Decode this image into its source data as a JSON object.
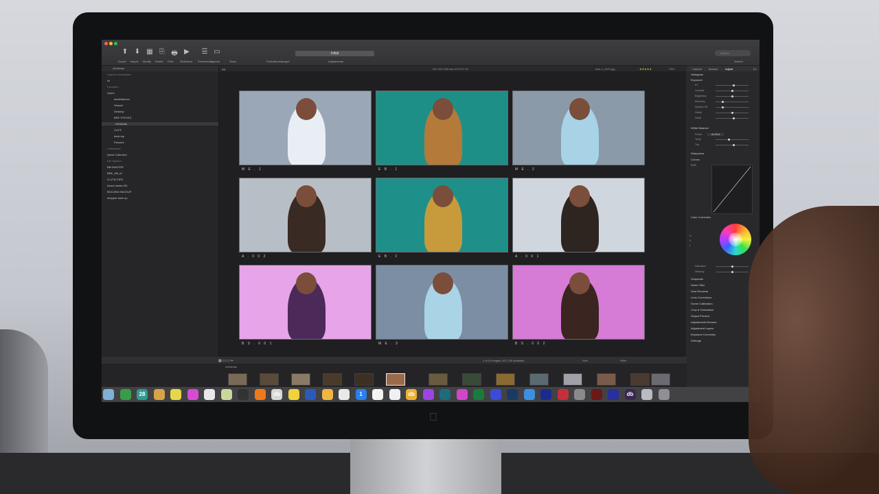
{
  "app": {
    "toolbar_items": [
      "Export",
      "Import",
      "Modify",
      "Delete",
      "Print",
      "Slideshow",
      "Preferences",
      "Layouts",
      "Show",
      "Portrait/Landscape",
      "Adjustments"
    ],
    "variant_name": "Initial",
    "search_placeholder": "Search",
    "search_label": "Search"
  },
  "left_panel": {
    "path": "christmas",
    "sections": [
      {
        "label": "Capture Destination",
        "kind": "hdr"
      },
      {
        "label": "lol",
        "kind": "item"
      },
      {
        "label": "Favorites",
        "kind": "hdr"
      },
      {
        "label": "Users",
        "kind": "item"
      },
      {
        "label": "danieldenton",
        "kind": "item"
      },
      {
        "label": "Shared",
        "kind": "item"
      },
      {
        "label": "Desktop",
        "kind": "item"
      },
      {
        "label": "BRE STEVES",
        "kind": "item"
      },
      {
        "label": "christmas",
        "kind": "sel"
      },
      {
        "label": "CLIFF",
        "kind": "item"
      },
      {
        "label": "desk top",
        "kind": "item"
      },
      {
        "label": "Pictures",
        "kind": "item"
      },
      {
        "label": "Collections",
        "kind": "hdr"
      },
      {
        "label": "Quick Collection",
        "kind": "item"
      },
      {
        "label": "File System",
        "kind": "hdr"
      },
      {
        "label": "BM MASTER",
        "kind": "item"
      },
      {
        "label": "BRE_DB_M",
        "kind": "item"
      },
      {
        "label": "G-UTILITIES",
        "kind": "item"
      },
      {
        "label": "lcloud media HD",
        "kind": "item"
      },
      {
        "label": "BOLDING BACKUP",
        "kind": "item"
      },
      {
        "label": "shopper back up",
        "kind": "item"
      }
    ]
  },
  "viewer": {
    "format_label": "jpg",
    "exif": "ISO 200   1/80 sec   f/2.8   FC 50",
    "filename": "look-1_0027.jpg",
    "rating": "★★★★★",
    "zoom": "75%",
    "thumbnails": [
      {
        "caption": "M E . 1",
        "bg": "#9aa7b6",
        "fig": "#e9eef5"
      },
      {
        "caption": "E B . 1",
        "bg": "#1e8f86",
        "fig": "#b37a3a"
      },
      {
        "caption": "M E . 2",
        "bg": "#8a9aa8",
        "fig": "#a8d2e6"
      },
      {
        "caption": "A . 0 0 2",
        "bg": "#b8bec6",
        "fig": "#3a2a24"
      },
      {
        "caption": "E B . 2",
        "bg": "#1f8f8a",
        "fig": "#c79a3c"
      },
      {
        "caption": "A . 0 0 1",
        "bg": "#cfd6de",
        "fig": "#2e2420"
      },
      {
        "caption": "B S . 0 0 1",
        "bg": "#e7a4e8",
        "fig": "#4b2a59"
      },
      {
        "caption": "M E . 3",
        "bg": "#7b8ea3",
        "fig": "#a9d4e6"
      },
      {
        "caption": "B S . 0 0 2",
        "bg": "#d67bd6",
        "fig": "#3a2520"
      }
    ],
    "status": "1 of 14 images, 63.1 GB available",
    "sort_label": "Sort:",
    "filter_label": "Filter:",
    "browser_path": "christmas"
  },
  "right_panel": {
    "tabs": [
      "Capture",
      "Browse",
      "Adjust",
      "Ex"
    ],
    "sections_top": [
      "Histogram",
      "Exposure"
    ],
    "exposure_controls": [
      {
        "label": "EV",
        "value": 0.55
      },
      {
        "label": "Contrast",
        "value": 0.5
      },
      {
        "label": "Brightness",
        "value": 0.5
      },
      {
        "label": "Recovery",
        "value": 0.2
      },
      {
        "label": "Shadow Fill",
        "value": 0.2
      },
      {
        "label": "Clarity",
        "value": 0.5
      },
      {
        "label": "Detail",
        "value": 0.55
      }
    ],
    "white_balance_title": "White Balance",
    "wb_preset_label": "Preset",
    "wb_preset_value": "As Shot",
    "wb_controls": [
      {
        "label": "Temp",
        "value": 0.4
      },
      {
        "label": "Tint",
        "value": 0.55
      }
    ],
    "sharpness_title": "Sharpness",
    "curves_title": "Curves",
    "curves_channel": "RGB",
    "color_correction_title": "Color Correction",
    "cc_sliders": [
      "H",
      "S",
      "L"
    ],
    "cc_controls": [
      {
        "label": "Saturation",
        "value": 0.5
      },
      {
        "label": "Vibrancy",
        "value": 0.5
      }
    ],
    "sections_bottom": [
      "Grayscale",
      "Noise Filter",
      "Dust Removal",
      "Lens Corrections",
      "Scene Calibration",
      "Crop & Orientation",
      "Output Preview",
      "Adjustments Browser",
      "Adjustment Layers",
      "Keystone Correction",
      "Defringe"
    ]
  },
  "dock": {
    "icons": [
      {
        "name": "finder-icon",
        "color": "#7fb1d6"
      },
      {
        "name": "chrome-icon",
        "color": "#3a9b4a"
      },
      {
        "name": "calendar-icon",
        "color": "#2f9a90",
        "text": "28"
      },
      {
        "name": "box-icon",
        "color": "#d6a347"
      },
      {
        "name": "notes-icon",
        "color": "#e6d64a"
      },
      {
        "name": "itunes-icon",
        "color": "#d84bd1"
      },
      {
        "name": "paper-icon",
        "color": "#e9e9e9"
      },
      {
        "name": "stickies-icon",
        "color": "#c8d89a"
      },
      {
        "name": "terminal-icon",
        "color": "#333"
      },
      {
        "name": "firefox-icon",
        "color": "#f07a1a"
      },
      {
        "name": "db-icon",
        "color": "#d8d8d8",
        "text": "db"
      },
      {
        "name": "sketch-icon",
        "color": "#f2d23a"
      },
      {
        "name": "photoshop-icon",
        "color": "#2b5bb8"
      },
      {
        "name": "pages-icon",
        "color": "#f0b640"
      },
      {
        "name": "numbers-icon",
        "color": "#e9e9e9"
      },
      {
        "name": "one-icon",
        "color": "#2a7ff0",
        "text": "1"
      },
      {
        "name": "ball-icon",
        "color": "#f4f4f4"
      },
      {
        "name": "ball2-icon",
        "color": "#f0f0f0"
      },
      {
        "name": "db2-icon",
        "color": "#f0b030",
        "text": "db"
      },
      {
        "name": "purple-icon",
        "color": "#9b45e0"
      },
      {
        "name": "teal-icon",
        "color": "#1c6c7a"
      },
      {
        "name": "pink-icon",
        "color": "#d046c9"
      },
      {
        "name": "green-icon",
        "color": "#1b7a3e"
      },
      {
        "name": "blue-icon",
        "color": "#3a4cd6"
      },
      {
        "name": "ps-icon",
        "color": "#1a3a66"
      },
      {
        "name": "mail-icon",
        "color": "#3d8fe0"
      },
      {
        "name": "navy-icon",
        "color": "#1a2a90"
      },
      {
        "name": "red-icon",
        "color": "#c2303a"
      },
      {
        "name": "gray-icon",
        "color": "#8a8a8e"
      },
      {
        "name": "darkred-icon",
        "color": "#6a1818"
      },
      {
        "name": "indigo-icon",
        "color": "#2a2e9e"
      },
      {
        "name": "db3-icon",
        "color": "#3a2850",
        "text": "db"
      },
      {
        "name": "cloud-icon",
        "color": "#b9bcc2"
      },
      {
        "name": "trash-icon",
        "color": "#8e9096"
      }
    ]
  }
}
